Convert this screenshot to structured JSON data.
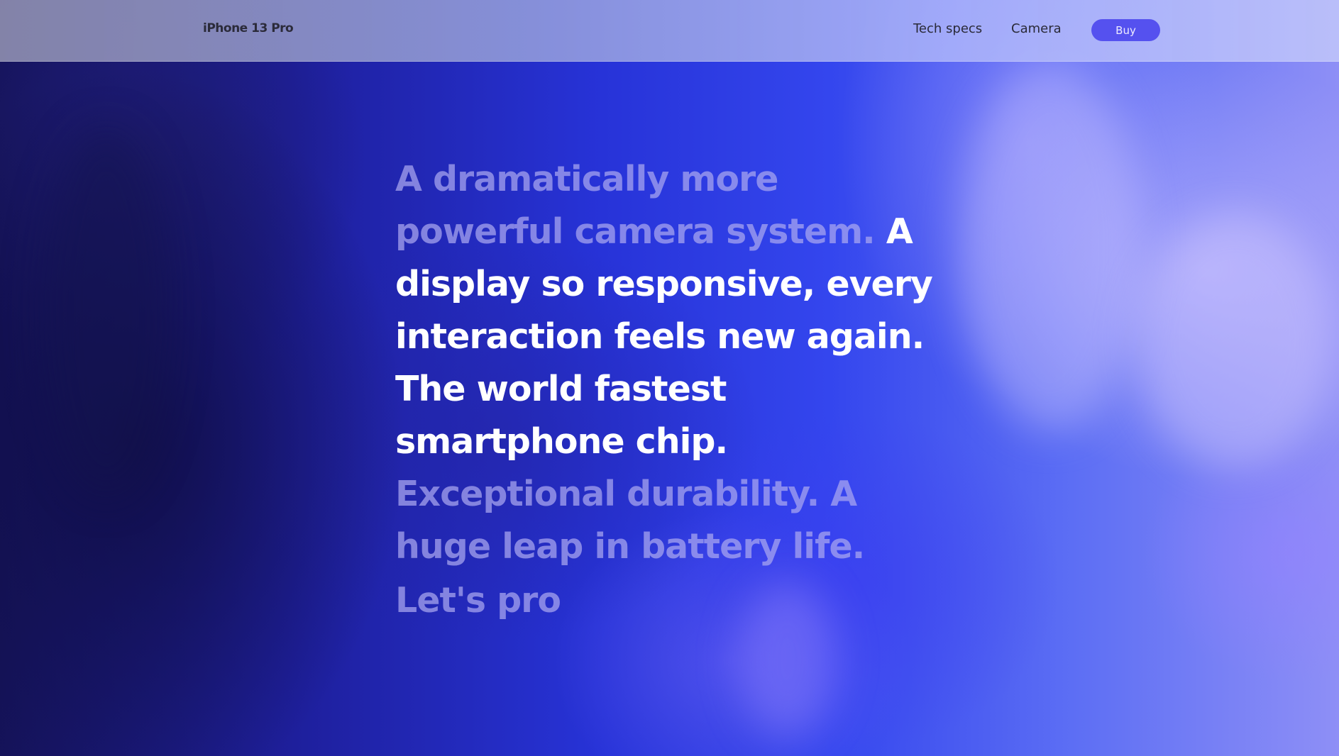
{
  "nav": {
    "brand": "iPhone 13 Pro",
    "links": [
      "Tech specs",
      "Camera"
    ],
    "buy_label": "Buy"
  },
  "hero": {
    "dim_intro": "A dramatically more powerful camera system.",
    "bright_middle": "A display so responsive, every interaction feels new again. The world fastest smartphone chip.",
    "dim_outro": "Exceptional durability. A huge leap in battery life.",
    "tagline": "Let's pro"
  },
  "colors": {
    "buy_button": "#5551ef",
    "highlight_text": "#ffffff",
    "muted_text": "#aaa8f0",
    "brand_text": "#2b2b3a"
  }
}
